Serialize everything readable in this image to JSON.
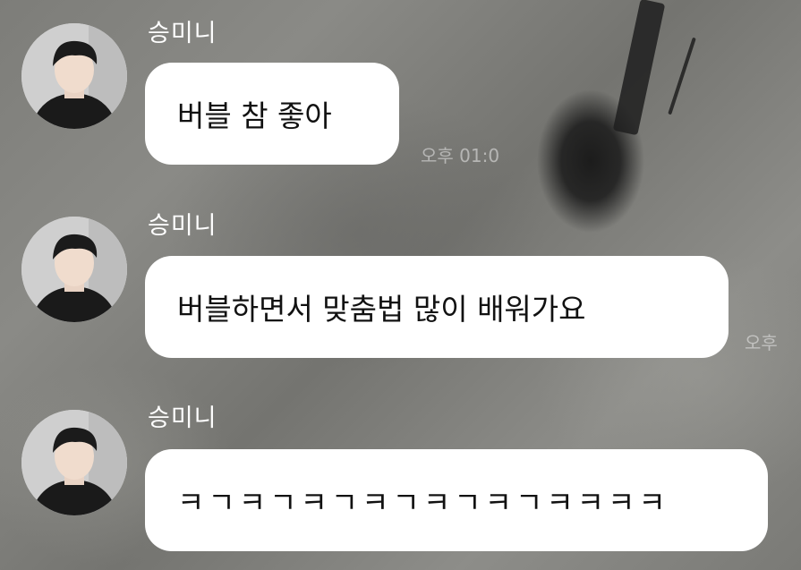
{
  "messages": [
    {
      "sender": "승미니",
      "text": "버블 참 좋아",
      "time": "오후 01:0"
    },
    {
      "sender": "승미니",
      "text": "버블하면서 맞춤법 많이 배워가요",
      "time": "오후"
    },
    {
      "sender": "승미니",
      "text": "ㅋㄱㅋㄱㅋㄱㅋㄱㅋㄱㅋㄱㅋㅋㅋㅋ",
      "time": ""
    }
  ],
  "colors": {
    "bubble": "#ffffff",
    "sender_name": "#ffffff",
    "background": "#7d7d79"
  }
}
